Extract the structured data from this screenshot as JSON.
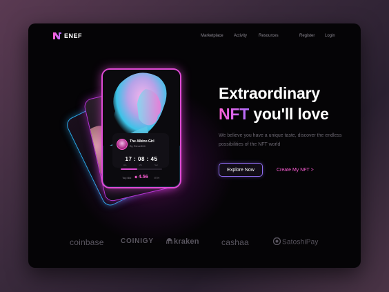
{
  "brand": {
    "name": "ENEF"
  },
  "nav": {
    "links": [
      "Marketplace",
      "Activity",
      "Resources"
    ],
    "register": "Register",
    "login": "Login"
  },
  "nft_card": {
    "name": "The Albino Girl",
    "owner": "By Steve504",
    "timer": "17 : 08 : 45",
    "timer_units": [
      "Hrs",
      "Min",
      "Sec"
    ],
    "bid_label": "Top Bid",
    "bid_value": "4.56",
    "bid_unit": "ETH",
    "progress": 0.4
  },
  "hero": {
    "title_line1": "Extraordinary",
    "title_accent": "NFT",
    "title_rest": "you'll love",
    "description": "We believe you have a unique taste, discover the endless possibilities of the NFT world",
    "explore_button": "Explore Now",
    "create_link": "Create My NFT  >"
  },
  "partners": [
    "coinbase",
    "COINIGY",
    "kraken",
    "cashaa",
    "SatoshiPay"
  ],
  "colors": {
    "accent_pink": "#ff5fd6",
    "accent_purple": "#b16dff",
    "frame_bg": "#050406"
  }
}
